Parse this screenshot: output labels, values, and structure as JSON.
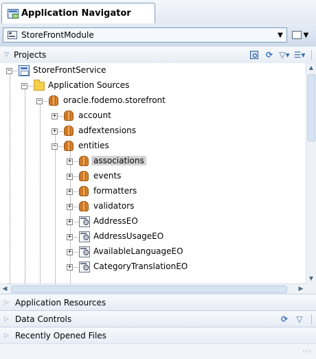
{
  "panel": {
    "tab_title": "Application Navigator",
    "module": "StoreFrontModule",
    "projects_label": "Projects"
  },
  "tree": [
    {
      "label": "StoreFrontService",
      "icon": "project-icon",
      "expander": "−"
    },
    {
      "label": "Application Sources",
      "icon": "folder-icon",
      "expander": "−"
    },
    {
      "label": "oracle.fodemo.storefront",
      "icon": "package-icon",
      "expander": "−"
    },
    {
      "label": "account",
      "icon": "package-icon",
      "expander": "+"
    },
    {
      "label": "adfextensions",
      "icon": "package-icon",
      "expander": "+"
    },
    {
      "label": "entities",
      "icon": "package-icon",
      "expander": "−"
    },
    {
      "label": "associations",
      "icon": "package-icon",
      "expander": "+",
      "selected": true
    },
    {
      "label": "events",
      "icon": "package-icon",
      "expander": "+"
    },
    {
      "label": "formatters",
      "icon": "package-icon",
      "expander": "+"
    },
    {
      "label": "validators",
      "icon": "package-icon",
      "expander": "+"
    },
    {
      "label": "AddressEO",
      "icon": "entity-object-icon",
      "expander": "+"
    },
    {
      "label": "AddressUsageEO",
      "icon": "entity-object-icon",
      "expander": "+"
    },
    {
      "label": "AvailableLanguageEO",
      "icon": "entity-object-icon",
      "expander": "+"
    },
    {
      "label": "CategoryTranslationEO",
      "icon": "entity-object-icon",
      "expander": "+"
    }
  ],
  "accordions": {
    "application_resources": "Application Resources",
    "data_controls": "Data Controls",
    "recently_opened": "Recently Opened Files"
  },
  "colors": {
    "selection": "#d4d4d4",
    "header_blue": "#cfdaea"
  }
}
